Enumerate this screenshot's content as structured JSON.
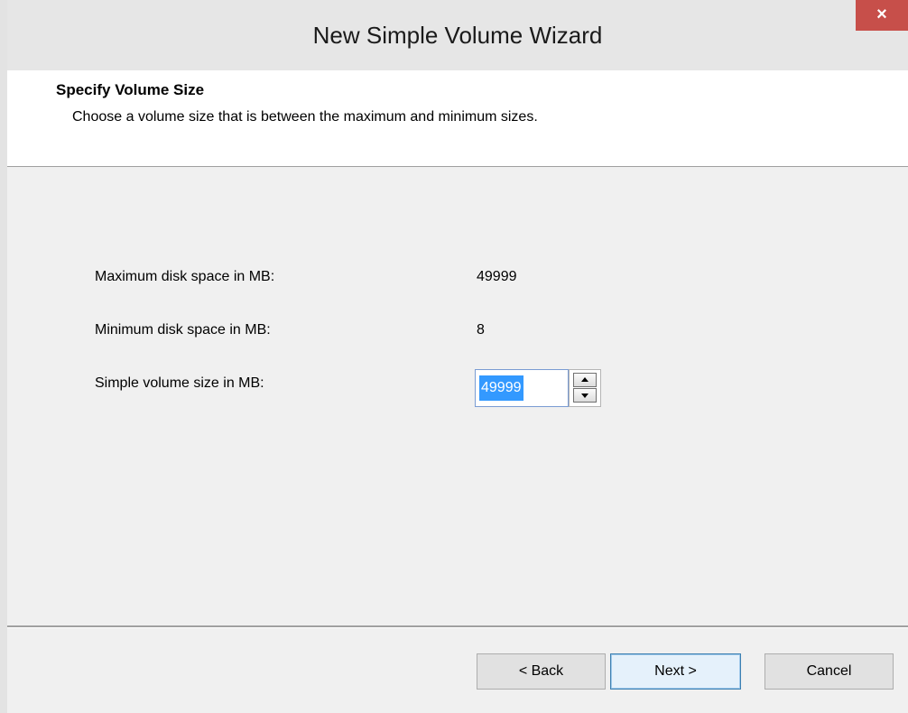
{
  "window": {
    "title": "New Simple Volume Wizard",
    "close_label": "×"
  },
  "header": {
    "title": "Specify Volume Size",
    "subtitle": "Choose a volume size that is between the maximum and minimum sizes."
  },
  "fields": {
    "max_label": "Maximum disk space in MB:",
    "max_value": "49999",
    "min_label": "Minimum disk space in MB:",
    "min_value": "8",
    "size_label": "Simple volume size in MB:",
    "size_value": "49999"
  },
  "buttons": {
    "back": "< Back",
    "next": "Next >",
    "cancel": "Cancel"
  },
  "colors": {
    "close_button": "#c74f4a",
    "selection": "#3399ff",
    "default_button_border": "#3c7fb1"
  }
}
